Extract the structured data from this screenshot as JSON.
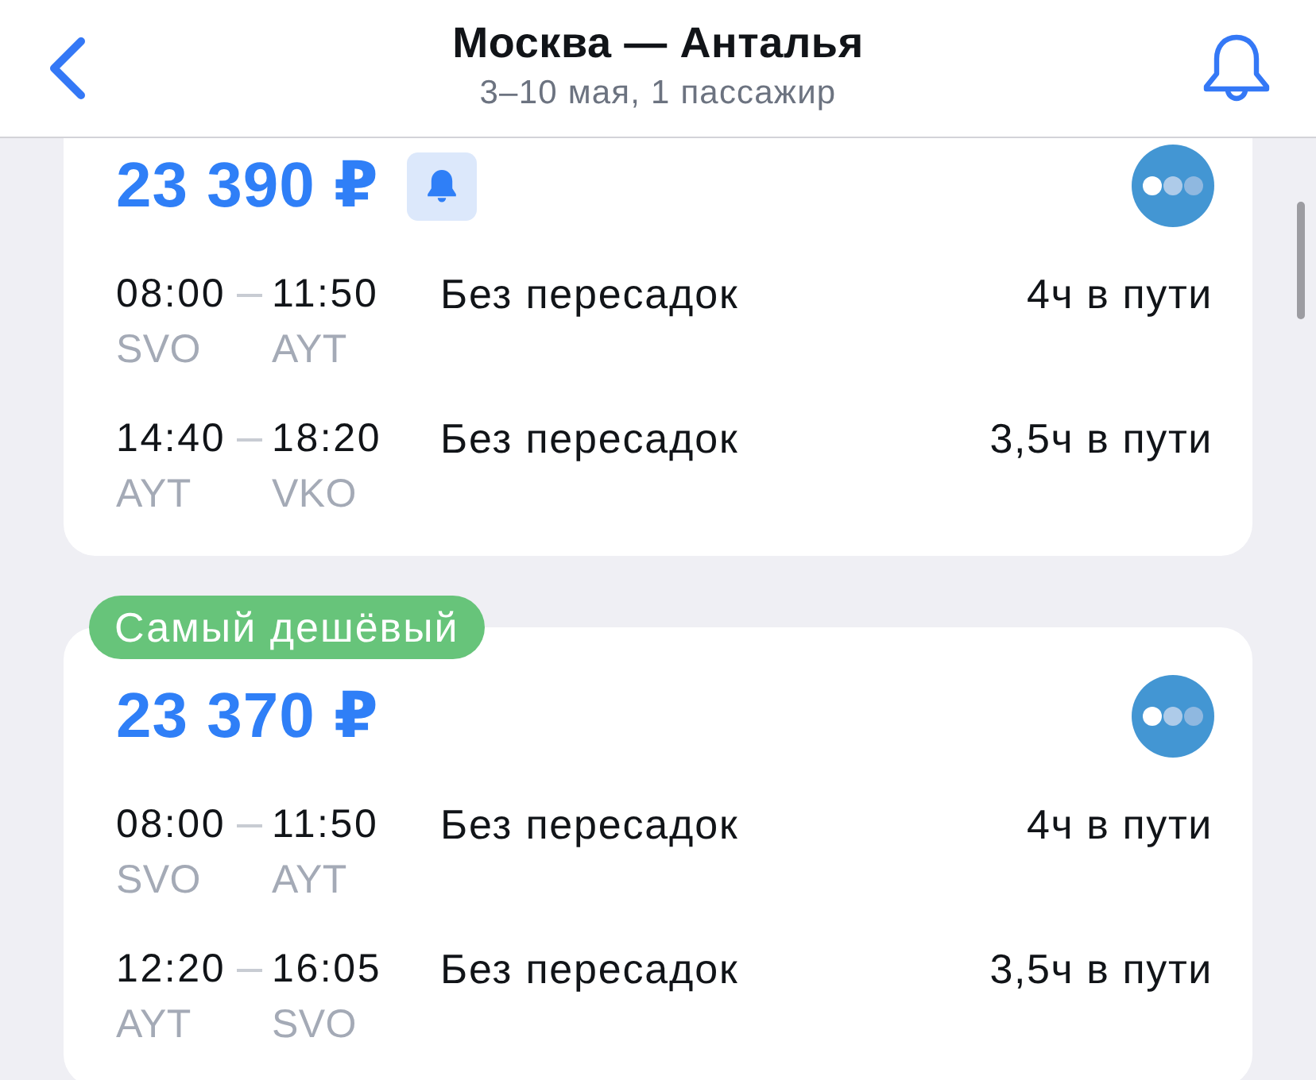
{
  "header": {
    "title": "Москва — Анталья",
    "subtitle": "3–10 мая, 1 пассажир"
  },
  "offers": [
    {
      "price": "23 390 ₽",
      "price_alert": true,
      "segments": [
        {
          "dep_time": "08:00",
          "arr_time": "11:50",
          "dep_airport": "SVO",
          "arr_airport": "AYT",
          "stops": "Без пересадок",
          "duration": "4ч в пути"
        },
        {
          "dep_time": "14:40",
          "arr_time": "18:20",
          "dep_airport": "AYT",
          "arr_airport": "VKO",
          "stops": "Без пересадок",
          "duration": "3,5ч в пути"
        }
      ]
    },
    {
      "label": "Самый дешёвый",
      "price": "23 370 ₽",
      "price_alert": false,
      "segments": [
        {
          "dep_time": "08:00",
          "arr_time": "11:50",
          "dep_airport": "SVO",
          "arr_airport": "AYT",
          "stops": "Без пересадок",
          "duration": "4ч в пути"
        },
        {
          "dep_time": "12:20",
          "arr_time": "16:05",
          "dep_airport": "AYT",
          "arr_airport": "SVO",
          "stops": "Без пересадок",
          "duration": "3,5ч в пути"
        }
      ]
    }
  ]
}
